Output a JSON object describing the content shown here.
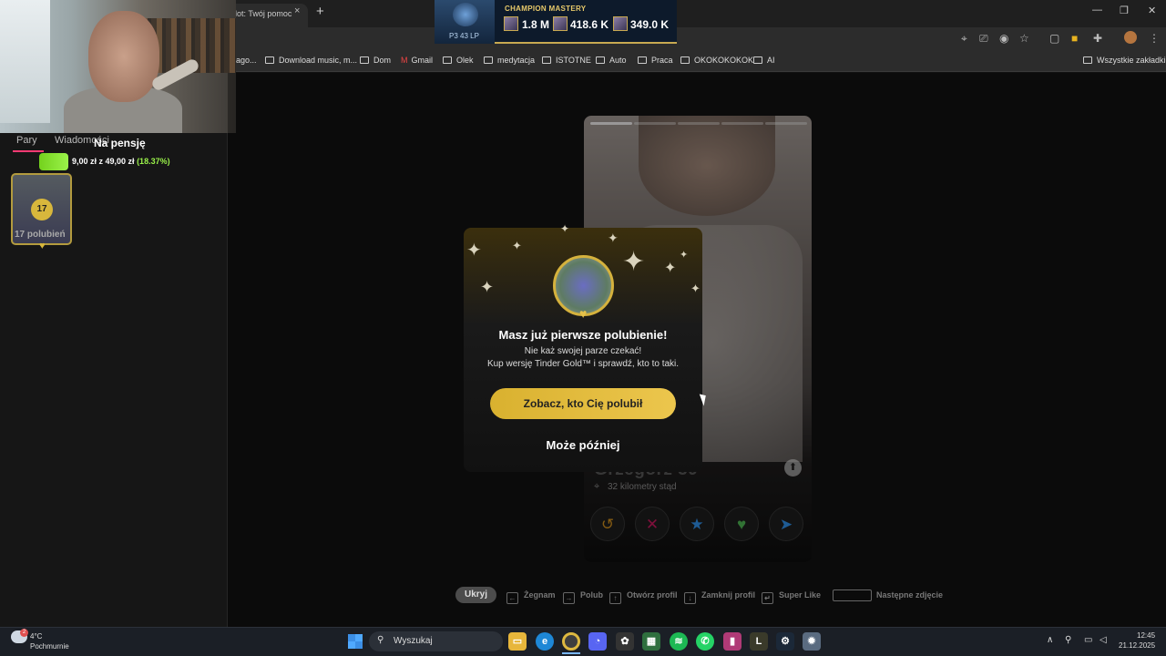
{
  "browser": {
    "tab_title": "lot: Twój pomoc",
    "tab_close": "×",
    "new_tab": "+",
    "window_controls": [
      "—",
      "❐",
      "✕"
    ],
    "bookmarks": [
      "ago...",
      "Download music, m...",
      "Dom",
      "Gmail",
      "Olek",
      "medytacja",
      "ISTOTNE",
      "Auto",
      "Praca",
      "OKOKOKOKOK",
      "AI"
    ],
    "all_bookmarks": "Wszystkie zakładki"
  },
  "champion": {
    "title": "CHAMPION MASTERY",
    "rank": "P3 43 LP",
    "stats": [
      "1.8 M",
      "418.6 K",
      "349.0 K"
    ]
  },
  "sidebar": {
    "tabs": [
      "Pary",
      "Wiadomości"
    ],
    "goal_title": "Na pensję",
    "goal_amount": "9,00 zł z 49,00 zł",
    "goal_percent": "(18.37%)",
    "goal_progress": 0.1837,
    "likes_count": "17",
    "likes_label": "17 polubień"
  },
  "profile": {
    "name": "Grzegorz 39",
    "distance": "32 kilometry stąd",
    "info_icon": "⬆",
    "actions": [
      {
        "name": "rewind",
        "glyph": "↺",
        "color": "#c98a1c"
      },
      {
        "name": "nope",
        "glyph": "✕",
        "color": "#c2185b"
      },
      {
        "name": "super-like",
        "glyph": "★",
        "color": "#2f8de4"
      },
      {
        "name": "like",
        "glyph": "♥",
        "color": "#4caf50"
      },
      {
        "name": "boost",
        "glyph": "➤",
        "color": "#2f8de4"
      }
    ]
  },
  "modal": {
    "title": "Masz już pierwsze polubienie!",
    "subtitle_1": "Nie każ swojej parze czekać!",
    "subtitle_2": "Kup wersję Tinder Gold™ i sprawdź, kto to taki.",
    "cta": "Zobacz, kto Cię polubił",
    "later": "Może później"
  },
  "hints": {
    "hide": "Ukryj",
    "items": [
      "Żegnam",
      "Polub",
      "Otwórz profil",
      "Zamknij profil",
      "Super Like",
      "Następne zdjęcie"
    ]
  },
  "taskbar": {
    "temperature": "4°C",
    "weather": "Pochmurnie",
    "weather_badge": "2",
    "search": "Wyszukaj",
    "time": "12:45",
    "date": "21.12.2025"
  }
}
